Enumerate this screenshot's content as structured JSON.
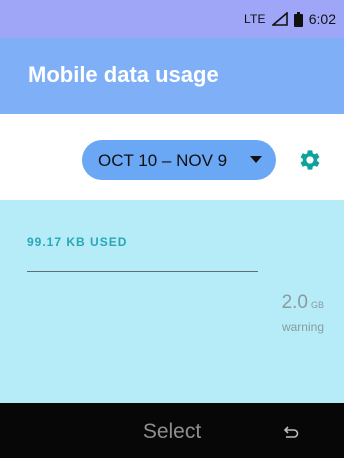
{
  "status_bar": {
    "network": "LTE",
    "time": "6:02",
    "icons": [
      "signal-icon",
      "battery-icon"
    ]
  },
  "app_bar": {
    "title": "Mobile data usage"
  },
  "cycle": {
    "range_label": "OCT 10 – NOV 9",
    "icon": "dropdown-arrow-icon"
  },
  "settings": {
    "icon": "gear-icon"
  },
  "usage": {
    "amount_label": "99.17 KB USED",
    "warning_value": "2.0",
    "warning_unit": "GB",
    "warning_label": "warning"
  },
  "softkeys": {
    "center_label": "Select",
    "right_icon": "back-icon"
  },
  "colors": {
    "status_bar": "#9fa6f7",
    "app_bar": "#7fb0f7",
    "chip": "#6aa7f5",
    "accent": "#0ea29a",
    "usage_panel": "#b5ecf8",
    "softkey_bar": "#070707"
  }
}
